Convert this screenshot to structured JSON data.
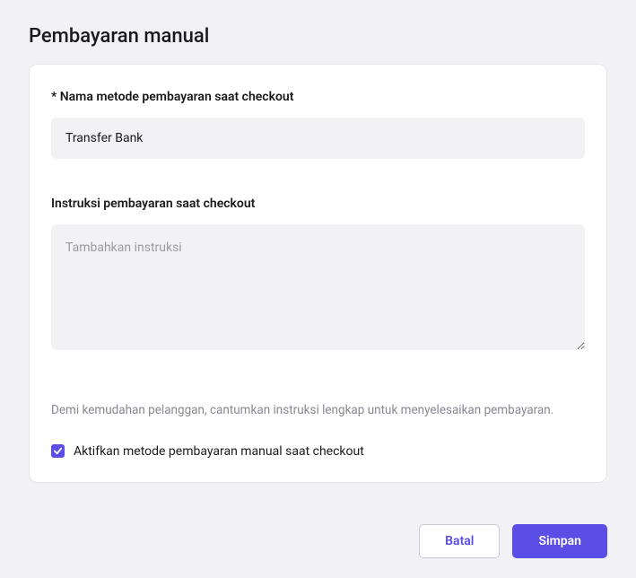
{
  "page": {
    "title": "Pembayaran manual"
  },
  "form": {
    "name_label": "* Nama metode pembayaran saat checkout",
    "name_value": "Transfer Bank",
    "instructions_label": "Instruksi pembayaran saat checkout",
    "instructions_placeholder": "Tambahkan instruksi",
    "instructions_value": "",
    "helper_text": "Demi kemudahan pelanggan, cantumkan instruksi lengkap untuk menyelesaikan pembayaran.",
    "enable_checkbox_label": "Aktifkan metode pembayaran manual saat checkout",
    "enable_checkbox_checked": true
  },
  "actions": {
    "cancel_label": "Batal",
    "save_label": "Simpan"
  }
}
